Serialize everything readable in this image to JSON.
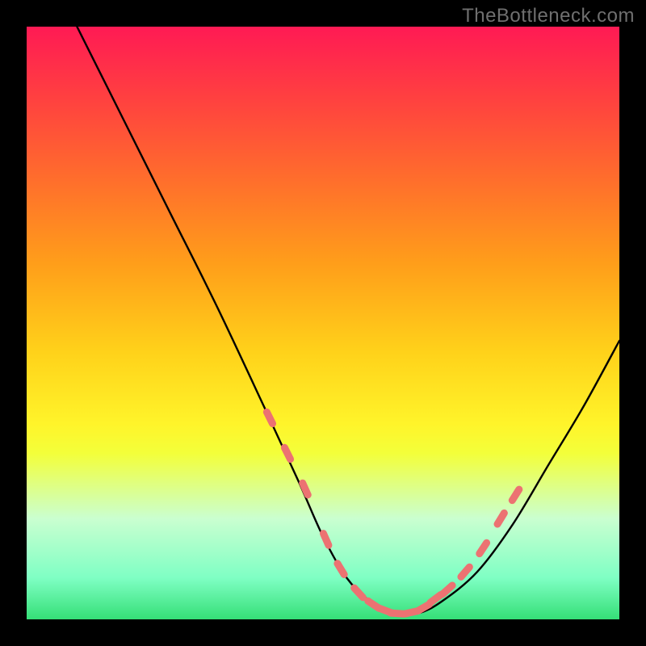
{
  "watermark": "TheBottleneck.com",
  "colors": {
    "page_bg": "#000000",
    "gradient_top": "#ff1a54",
    "gradient_bottom": "#35df77",
    "curve": "#000000",
    "marker": "#ec7272",
    "watermark_text": "#6f6f6f"
  },
  "chart_data": {
    "type": "line",
    "title": "",
    "xlabel": "",
    "ylabel": "",
    "xlim": [
      0,
      100
    ],
    "ylim": [
      0,
      100
    ],
    "grid": false,
    "legend": false,
    "series": [
      {
        "name": "bottleneck-curve",
        "x": [
          0,
          8,
          16,
          24,
          32,
          40,
          46,
          50,
          54,
          58,
          62,
          66,
          70,
          76,
          82,
          88,
          94,
          100
        ],
        "y": [
          117,
          101,
          85,
          69,
          53,
          36,
          23,
          14,
          7,
          3,
          1,
          1,
          3,
          8,
          16,
          26,
          36,
          47
        ]
      }
    ],
    "markers": {
      "name": "highlighted-segment",
      "x": [
        41,
        44,
        47,
        50.5,
        53,
        56,
        58.5,
        60.5,
        62.5,
        65,
        67,
        69,
        71,
        74,
        77,
        80,
        82.5
      ],
      "y": [
        34,
        28,
        22,
        13.5,
        8.5,
        4.5,
        2.5,
        1.5,
        1,
        1.2,
        2,
        3.5,
        5,
        8,
        12,
        17,
        21
      ]
    }
  }
}
